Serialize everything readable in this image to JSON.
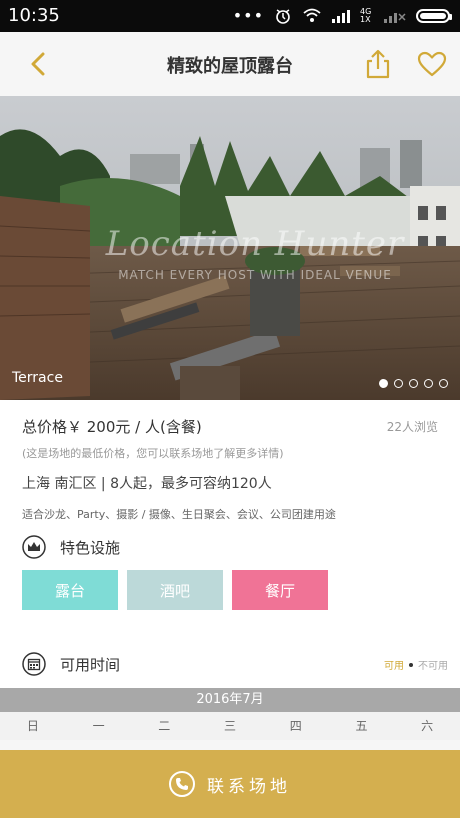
{
  "status_bar": {
    "time": "10:35",
    "signal_label": "4G 1X"
  },
  "navbar": {
    "title": "精致的屋顶露台"
  },
  "hero": {
    "caption": "Terrace",
    "watermark_title": "Location Hunter",
    "watermark_subtitle": "MATCH EVERY HOST WITH IDEAL VENUE",
    "carousel_count": 5,
    "carousel_active": 1
  },
  "venue": {
    "price": "总价格￥ 200元 / 人(含餐)",
    "views": "22人浏览",
    "price_note": "(这是场地的最低价格，您可以联系场地了解更多详情)",
    "location": "上海 南汇区 | 8人起，最多可容纳120人",
    "uses": "适合沙龙、Party、摄影 / 摄像、生日聚会、会议、公司团建用途"
  },
  "features": {
    "title": "特色设施",
    "tags": [
      {
        "label": "露台",
        "color": "#7fdcd6"
      },
      {
        "label": "酒吧",
        "color": "#bcd9d9"
      },
      {
        "label": "餐厅",
        "color": "#f07396"
      }
    ]
  },
  "availability": {
    "title": "可用时间",
    "legend_available": "可用",
    "legend_unavailable": "不可用",
    "month": "2016年7月",
    "weekdays": [
      "日",
      "一",
      "二",
      "三",
      "四",
      "五",
      "六"
    ]
  },
  "contact": {
    "label": "联系场地"
  },
  "colors": {
    "accent": "#d4af4f",
    "nav_icon": "#d1a938"
  }
}
